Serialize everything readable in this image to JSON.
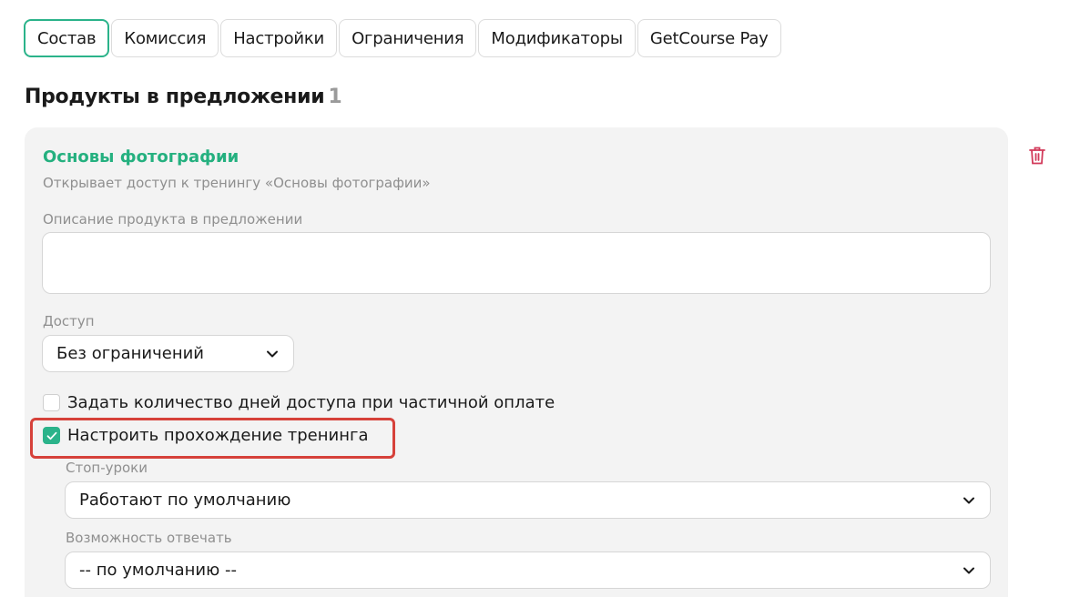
{
  "tabs": [
    {
      "label": "Состав",
      "active": true
    },
    {
      "label": "Комиссия"
    },
    {
      "label": "Настройки"
    },
    {
      "label": "Ограничения"
    },
    {
      "label": "Модификаторы"
    },
    {
      "label": "GetCourse Pay"
    }
  ],
  "section": {
    "title": "Продукты в предложении",
    "count": "1"
  },
  "product": {
    "name": "Основы фотографии",
    "description": "Открывает доступ к тренингу «Основы фотографии»",
    "desc_field_label": "Описание продукта в предложении",
    "desc_field_value": "",
    "access_label": "Доступ",
    "access_value": "Без ограничений",
    "partial_days_label": "Задать количество дней доступа при частичной оплате",
    "partial_days_checked": false,
    "training_setup_label": "Настроить прохождение тренинга",
    "training_setup_checked": true,
    "stop_lessons_label": "Стоп-уроки",
    "stop_lessons_value": "Работают по умолчанию",
    "reply_label": "Возможность отвечать",
    "reply_value": "-- по умолчанию --"
  },
  "colors": {
    "accent": "#2bb38a",
    "product_name": "#24b07f",
    "highlight": "#d6413a",
    "delete_icon": "#d23a5a"
  },
  "icons": {
    "delete": "trash-icon",
    "dropdown": "chevron-down-icon",
    "check": "check-icon"
  }
}
